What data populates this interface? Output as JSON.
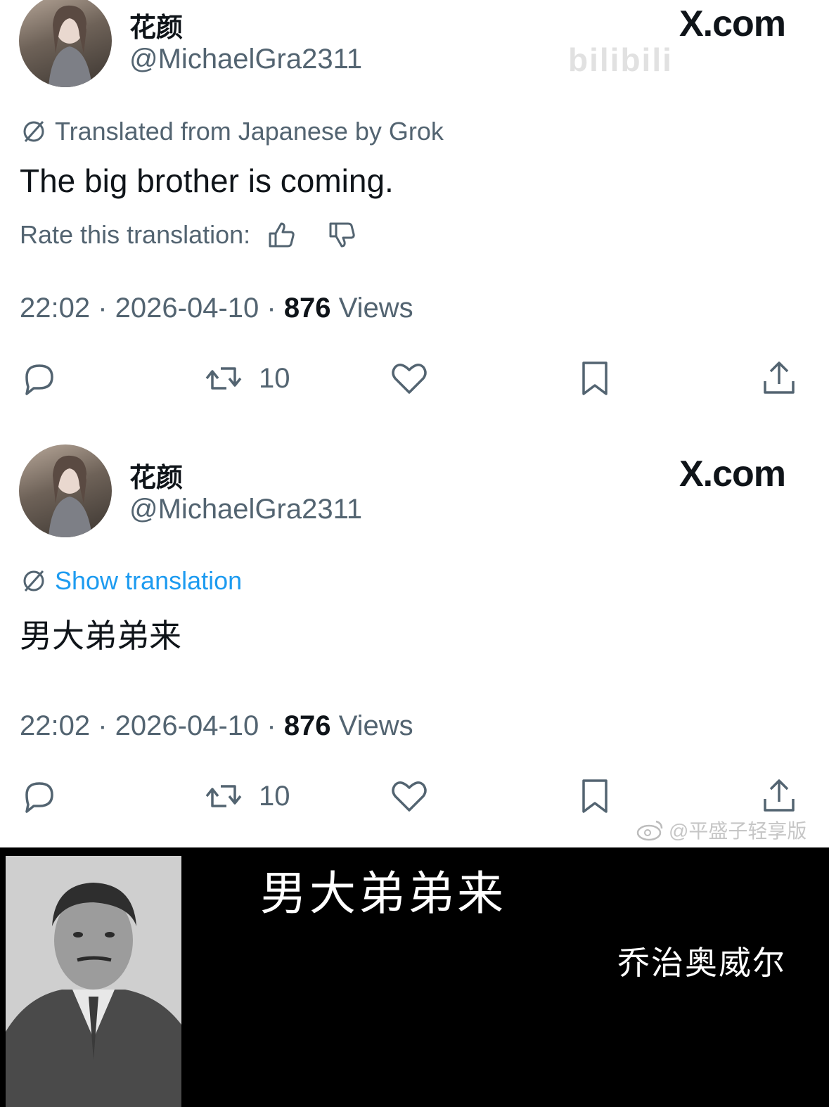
{
  "tweet1": {
    "display_name": "花颜",
    "handle": "@MichaelGra2311",
    "site_logo": "X.com",
    "watermark": "bilibili",
    "translation_notice": "Translated from Japanese by Grok",
    "text": "The big brother is coming.",
    "rate_label": "Rate this translation:",
    "time": "22:02",
    "date": "2026-04-10",
    "views_count": "876",
    "views_label": "Views",
    "retweets": "10",
    "icons": [
      "translate-icon",
      "thumbs-up-icon",
      "thumbs-down-icon",
      "reply-icon",
      "retweet-icon",
      "like-icon",
      "bookmark-icon",
      "share-icon"
    ]
  },
  "tweet2": {
    "display_name": "花颜",
    "handle": "@MichaelGra2311",
    "site_logo": "X.com",
    "translation_link": "Show translation",
    "text": "男大弟弟来",
    "time": "22:02",
    "date": "2026-04-10",
    "views_count": "876",
    "views_label": "Views",
    "retweets": "10"
  },
  "weibo_watermark": "@平盛子轻享版",
  "bottom": {
    "caption": "男大弟弟来",
    "attribution": "乔治奥威尔"
  },
  "colors": {
    "text_primary": "#0f1419",
    "text_secondary": "#536471",
    "link": "#1d9bf0",
    "panel_background": "#000000"
  }
}
